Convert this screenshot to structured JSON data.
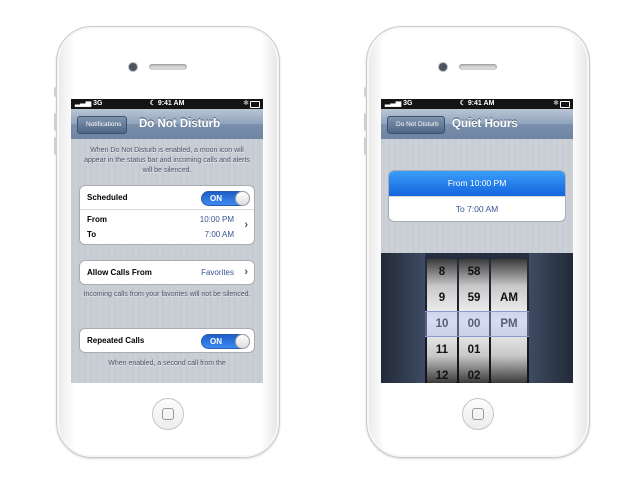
{
  "left_phone": {
    "status": {
      "carrier": "3G",
      "time": "9:41 AM"
    },
    "nav": {
      "back_label": "Notifications",
      "title": "Do Not Disturb"
    },
    "intro": "When Do Not Disturb is enabled, a moon icon will appear in the status bar and incoming calls and alerts will be silenced.",
    "scheduled": {
      "label": "Scheduled",
      "switch": "ON",
      "from_label": "From",
      "from_value": "10:00 PM",
      "to_label": "To",
      "to_value": "7:00 AM"
    },
    "allow_calls": {
      "label": "Allow Calls From",
      "value": "Favorites",
      "footer": "Incoming calls from your favorites will not be silenced."
    },
    "repeated_calls": {
      "label": "Repeated Calls",
      "switch": "ON",
      "footer": "When enabled, a second call from the"
    }
  },
  "right_phone": {
    "status": {
      "carrier": "3G",
      "time": "9:41 AM"
    },
    "nav": {
      "back_label": "Do Not Disturb",
      "title": "Quiet Hours"
    },
    "from_row": "From 10:00 PM",
    "to_row": "To 7:00 AM",
    "picker": {
      "hours": [
        "8",
        "9",
        "10",
        "11",
        "12"
      ],
      "minutes": [
        "58",
        "59",
        "00",
        "01",
        "02"
      ],
      "ampm": [
        "",
        "AM",
        "PM",
        "",
        ""
      ]
    }
  },
  "colors": {
    "switch_on": "#2d73e0",
    "selected_row": "#1c6fe6",
    "nav_bar": "#7a8fab"
  }
}
